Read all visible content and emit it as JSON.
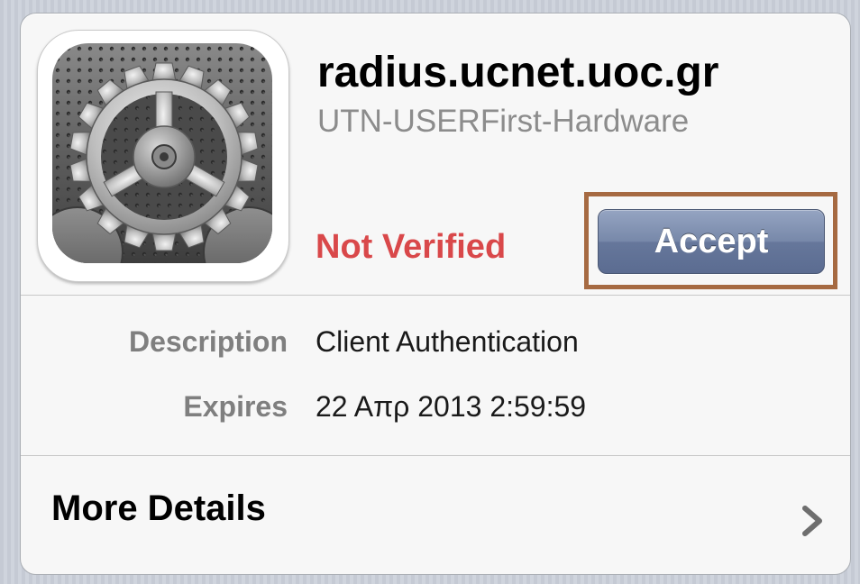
{
  "certificate": {
    "title": "radius.ucnet.uoc.gr",
    "issuer": "UTN-USERFirst-Hardware",
    "status": "Not Verified",
    "icon": "settings-gears-icon"
  },
  "actions": {
    "accept_label": "Accept"
  },
  "details": [
    {
      "label": "Description",
      "value": "Client Authentication"
    },
    {
      "label": "Expires",
      "value": "22 Απρ 2013 2:59:59"
    }
  ],
  "more": {
    "label": "More Details",
    "icon": "chevron-right-icon"
  },
  "colors": {
    "status": "#d9484a",
    "accept_button": "#6b7ca0",
    "highlight": "#a66a42"
  }
}
